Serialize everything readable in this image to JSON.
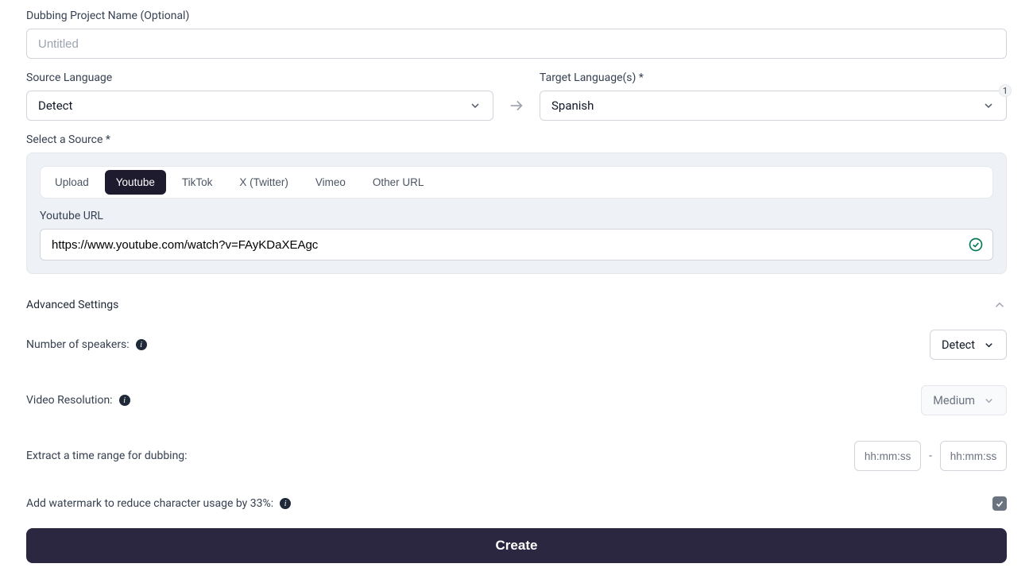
{
  "project": {
    "label": "Dubbing Project Name (Optional)",
    "placeholder": "Untitled",
    "value": ""
  },
  "source_lang": {
    "label": "Source Language",
    "value": "Detect"
  },
  "target_lang": {
    "label": "Target Language(s) *",
    "value": "Spanish",
    "count": "1"
  },
  "source_select": {
    "label": "Select a Source *",
    "tabs": [
      "Upload",
      "Youtube",
      "TikTok",
      "X (Twitter)",
      "Vimeo",
      "Other URL"
    ],
    "active_index": 1,
    "url_label": "Youtube URL",
    "url_value": "https://www.youtube.com/watch?v=FAyKDaXEAgc"
  },
  "advanced": {
    "header": "Advanced Settings",
    "speakers": {
      "label": "Number of speakers:",
      "value": "Detect"
    },
    "resolution": {
      "label": "Video Resolution:",
      "value": "Medium"
    },
    "timerange": {
      "label": "Extract a time range for dubbing:",
      "start_placeholder": "hh:mm:ss",
      "end_placeholder": "hh:mm:ss",
      "start_value": "",
      "end_value": ""
    },
    "watermark": {
      "label": "Add watermark to reduce character usage by 33%:",
      "checked": true
    }
  },
  "submit": {
    "label": "Create"
  }
}
